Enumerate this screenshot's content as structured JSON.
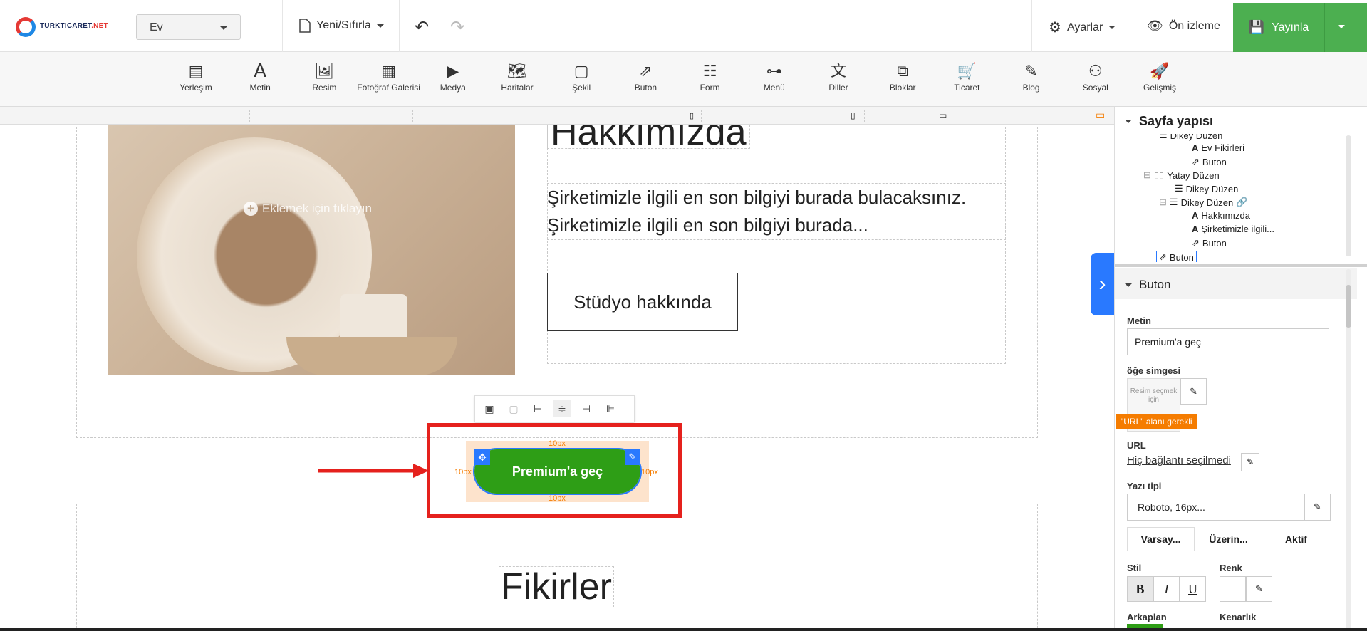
{
  "header": {
    "logo_text": "TURKTICARET",
    "logo_suffix": ".NET",
    "page_select": "Ev",
    "reset_label": "Yeni/Sıfırla",
    "settings_label": "Ayarlar",
    "preview_label": "Ön izleme",
    "publish_label": "Yayınla"
  },
  "toolbar": {
    "items": [
      {
        "label": "Yerleşim",
        "icon": "layout-icon"
      },
      {
        "label": "Metin",
        "icon": "text-icon"
      },
      {
        "label": "Resim",
        "icon": "image-icon"
      },
      {
        "label": "Fotoğraf Galerisi",
        "icon": "gallery-icon"
      },
      {
        "label": "Medya",
        "icon": "media-icon"
      },
      {
        "label": "Haritalar",
        "icon": "map-icon"
      },
      {
        "label": "Şekil",
        "icon": "shape-icon"
      },
      {
        "label": "Buton",
        "icon": "button-icon"
      },
      {
        "label": "Form",
        "icon": "form-icon"
      },
      {
        "label": "Menü",
        "icon": "menu-icon"
      },
      {
        "label": "Diller",
        "icon": "language-icon"
      },
      {
        "label": "Bloklar",
        "icon": "blocks-icon"
      },
      {
        "label": "Ticaret",
        "icon": "cart-icon"
      },
      {
        "label": "Blog",
        "icon": "blog-icon"
      },
      {
        "label": "Sosyal",
        "icon": "social-icon"
      },
      {
        "label": "Gelişmiş",
        "icon": "rocket-icon"
      }
    ]
  },
  "canvas": {
    "heading_partial": "Hakkımızda",
    "paragraph_line1": "Şirketimizle ilgili en son bilgiyi burada bulacaksınız.",
    "paragraph_line2": "Şirketimizle ilgili en son bilgiyi burada...",
    "image_hint": "Eklemek için tıklayın",
    "studio_button": "Stüdyo hakkında",
    "premium_button": "Premium'a geç",
    "padding_label": "10px",
    "section_heading": "Fikirler"
  },
  "sidebar": {
    "structure_title": "Sayfa yapısı",
    "tree": [
      {
        "label": "Dikey Düzen"
      },
      {
        "label": "Ev Fikirleri"
      },
      {
        "label": "Buton"
      },
      {
        "label": "Yatay Düzen"
      },
      {
        "label": "Dikey Düzen"
      },
      {
        "label": "Dikey Düzen"
      },
      {
        "label": "Hakkımızda"
      },
      {
        "label": "Şirketimizle ilgili..."
      },
      {
        "label": "Buton"
      },
      {
        "label": "Buton"
      }
    ],
    "props_title": "Buton",
    "text_label": "Metin",
    "text_value": "Premium'a geç",
    "icon_label": "öğe simgesi",
    "icon_placeholder": "Resim seçmek için",
    "url_warning": "\"URL\" alanı gerekli",
    "url_label": "URL",
    "url_value": "Hiç bağlantı seçilmedi",
    "font_label": "Yazı tipi",
    "font_value": "Roboto, 16px...",
    "tabs": [
      "Varsay...",
      "Üzerin...",
      "Aktif"
    ],
    "style_label": "Stil",
    "color_label": "Renk",
    "bold": "B",
    "italic": "I",
    "underline": "U",
    "bg_label": "Arkaplan",
    "border_label": "Kenarlık"
  },
  "colors": {
    "publish": "#4caf50",
    "premium_button": "#2e9e16",
    "highlight": "#e5211d",
    "warning": "#f57c00",
    "selection": "#2979ff"
  }
}
